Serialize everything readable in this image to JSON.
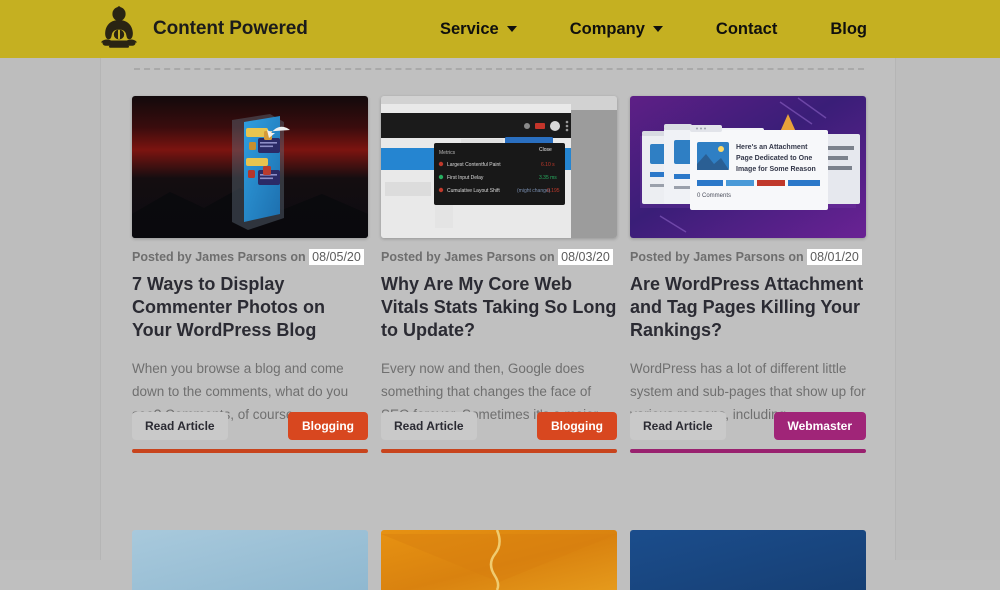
{
  "header": {
    "brand_name": "Content Powered",
    "logo_icon": "buddha-logo-icon",
    "background_color": "#c5b021",
    "nav": [
      {
        "label": "Service",
        "has_dropdown": true,
        "icon": "chevron-down-icon"
      },
      {
        "label": "Company",
        "has_dropdown": true,
        "icon": "chevron-down-icon"
      },
      {
        "label": "Contact",
        "has_dropdown": false
      },
      {
        "label": "Blog",
        "has_dropdown": false
      }
    ]
  },
  "main": {
    "read_article_label": "Read Article",
    "posts": [
      {
        "meta_prefix": "Posted by James Parsons on",
        "date": "08/05/20",
        "title": "7 Ways to Display Commenter Photos on Your WordPress Blog",
        "excerpt": "When you browse a blog and come down to the comments, what do you see? Comments, of course.",
        "tag": "Blogging",
        "tag_color": "#d8471f",
        "thumb_name": "phone-chat-illustration-thumbnail"
      },
      {
        "meta_prefix": "Posted by James Parsons on",
        "date": "08/03/20",
        "title": "Why Are My Core Web Vitals Stats Taking So Long to Update?",
        "excerpt": "Every now and then, Google does something that changes the face of SEO forever. Sometimes it's a major...",
        "tag": "Blogging",
        "tag_color": "#d8471f",
        "thumb_name": "browser-web-vitals-metrics-thumbnail"
      },
      {
        "meta_prefix": "Posted by James Parsons on",
        "date": "08/01/20",
        "title": "Are WordPress Attachment and Tag Pages Killing Your Rankings?",
        "excerpt": "WordPress has a lot of different little system and sub-pages that show up for various reasons, including...",
        "tag": "Webmaster",
        "tag_color": "#a02578",
        "thumb_name": "stacked-attachment-pages-thumbnail"
      }
    ],
    "next_row_thumbs": [
      {
        "thumb_name": "light-blue-thumbnail",
        "color": "#9cc0d4"
      },
      {
        "thumb_name": "orange-thumbnail",
        "color": "#e08c17"
      },
      {
        "thumb_name": "navy-blue-thumbnail",
        "color": "#194a85"
      }
    ]
  }
}
